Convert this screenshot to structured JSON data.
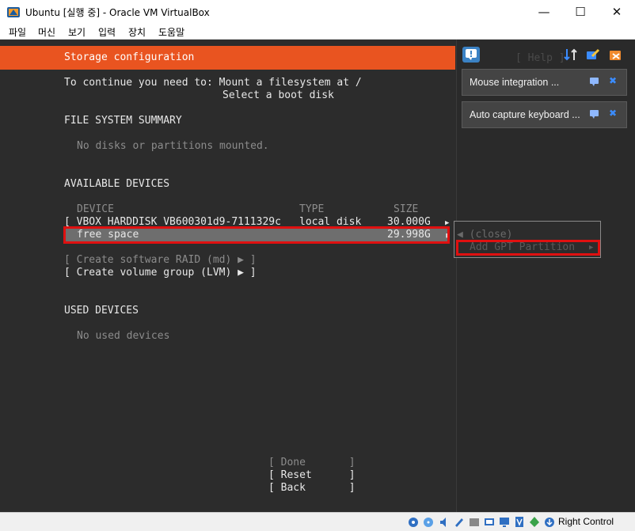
{
  "window": {
    "title": "Ubuntu [실행 중] - Oracle VM VirtualBox",
    "minimize_glyph": "—",
    "maximize_glyph": "☐",
    "close_glyph": "✕"
  },
  "menubar": {
    "items": [
      "파일",
      "머신",
      "보기",
      "입력",
      "장치",
      "도움말"
    ]
  },
  "installer": {
    "header_title": "Storage configuration",
    "help_label": "[ Help ]",
    "intro_line1": "To continue you need to: Mount a filesystem at /",
    "intro_line2": "Select a boot disk",
    "fs_summary_heading": "FILE SYSTEM SUMMARY",
    "fs_summary_empty": "No disks or partitions mounted.",
    "available_heading": "AVAILABLE DEVICES",
    "col_device": "DEVICE",
    "col_type": "TYPE",
    "col_size": "SIZE",
    "disk_row": {
      "device": "[ VBOX_HARDDISK_VB600301d9-7111329c",
      "type": "local disk",
      "size": "30.000G"
    },
    "free_row": {
      "device": "free space",
      "size": "29.998G"
    },
    "create_raid": "[ Create software RAID (md) ▶ ]",
    "create_lvm": "[ Create volume group (LVM) ▶ ]",
    "used_heading": "USED DEVICES",
    "used_empty": "No used devices",
    "buttons": {
      "done": "[ Done       ]",
      "reset": "[ Reset      ]",
      "back": "[ Back       ]"
    },
    "popup": {
      "close": "◀ (close)",
      "add_gpt": "Add GPT Partition",
      "add_gpt_arrow": "▶"
    }
  },
  "notifications": {
    "mouse": "Mouse integration ...",
    "keyboard": "Auto capture keyboard ..."
  },
  "statusbar": {
    "host_key": "Right Control"
  },
  "colors": {
    "accent": "#e95420",
    "highlight": "#e01010",
    "terminal_bg": "#2c2c2c"
  }
}
